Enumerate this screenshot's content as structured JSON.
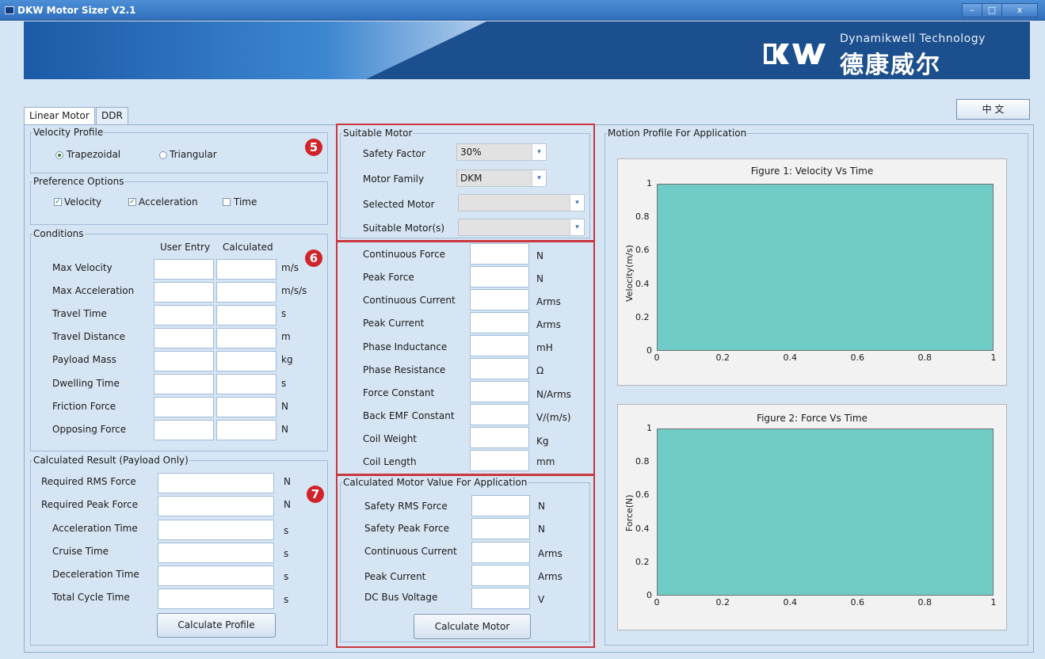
{
  "window": {
    "title": "DKW Motor Sizer V2.1",
    "minimize": "–",
    "maximize": "□",
    "close": "x"
  },
  "banner": {
    "company_en": "Dynamikwell Technology",
    "company_cn": "德康威尔"
  },
  "tabs": [
    {
      "label": "Linear Motor"
    },
    {
      "label": "DDR"
    }
  ],
  "lang_button": "中 文",
  "velocity_profile": {
    "legend": "Velocity Profile",
    "options": [
      {
        "label": "Trapezoidal",
        "selected": true
      },
      {
        "label": "Triangular",
        "selected": false
      }
    ]
  },
  "preference_options": {
    "legend": "Preference Options",
    "options": [
      {
        "label": "Velocity",
        "checked": true
      },
      {
        "label": "Acceleration",
        "checked": true
      },
      {
        "label": "Time",
        "checked": false
      }
    ]
  },
  "conditions": {
    "legend": "Conditions",
    "col_user": "User Entry",
    "col_calc": "Calculated",
    "rows": [
      {
        "label": "Max Velocity",
        "unit": "m/s"
      },
      {
        "label": "Max Acceleration",
        "unit": "m/s/s"
      },
      {
        "label": "Travel Time",
        "unit": "s"
      },
      {
        "label": "Travel Distance",
        "unit": "m"
      },
      {
        "label": "Payload Mass",
        "unit": "kg"
      },
      {
        "label": "Dwelling Time",
        "unit": "s"
      },
      {
        "label": "Friction Force",
        "unit": "N"
      },
      {
        "label": "Opposing Force",
        "unit": "N"
      }
    ]
  },
  "calculated_result": {
    "legend": "Calculated Result (Payload Only)",
    "rows": [
      {
        "label": "Required RMS Force",
        "unit": "N"
      },
      {
        "label": "Required Peak Force",
        "unit": "N"
      },
      {
        "label": "Acceleration Time",
        "unit": "s"
      },
      {
        "label": "Cruise Time",
        "unit": "s"
      },
      {
        "label": "Deceleration Time",
        "unit": "s"
      },
      {
        "label": "Total Cycle Time",
        "unit": "s"
      }
    ],
    "button": "Calculate Profile"
  },
  "badges": {
    "b5": "5",
    "b6": "6",
    "b7": "7"
  },
  "suitable_motor": {
    "legend": "Suitable Motor",
    "safety_factor_label": "Safety Factor",
    "safety_factor_value": "30%",
    "motor_family_label": "Motor Family",
    "motor_family_value": "DKM",
    "selected_motor_label": "Selected Motor",
    "selected_motor_value": "",
    "suitable_motors_label": "Suitable Motor(s)",
    "suitable_motors_value": ""
  },
  "motor_params": [
    {
      "label": "Continuous Force",
      "unit": "N"
    },
    {
      "label": "Peak Force",
      "unit": "N"
    },
    {
      "label": "Continuous Current",
      "unit": "Arms"
    },
    {
      "label": "Peak Current",
      "unit": "Arms"
    },
    {
      "label": "Phase Inductance",
      "unit": "mH"
    },
    {
      "label": "Phase Resistance",
      "unit": "Ω"
    },
    {
      "label": "Force Constant",
      "unit": "N/Arms"
    },
    {
      "label": "Back EMF Constant",
      "unit": "V/(m/s)"
    },
    {
      "label": "Coil Weight",
      "unit": "Kg"
    },
    {
      "label": "Coil Length",
      "unit": "mm"
    }
  ],
  "calc_motor_value": {
    "legend": "Calculated Motor Value For Application",
    "rows": [
      {
        "label": "Safety RMS Force",
        "unit": "N"
      },
      {
        "label": "Safety Peak Force",
        "unit": "N"
      },
      {
        "label": "Continuous Current",
        "unit": "Arms"
      },
      {
        "label": "Peak Current",
        "unit": "Arms"
      },
      {
        "label": "DC Bus Voltage",
        "unit": "V"
      }
    ],
    "button": "Calculate Motor"
  },
  "motion_profile": {
    "legend": "Motion Profile For Application"
  },
  "chart_data": [
    {
      "type": "area",
      "title": "Figure 1: Velocity Vs Time",
      "ylabel": "Velocity(m/s)",
      "xlabel": "",
      "xlim": [
        0,
        1
      ],
      "ylim": [
        0,
        1
      ],
      "xticks": [
        "0",
        "0.2",
        "0.4",
        "0.6",
        "0.8",
        "1"
      ],
      "yticks": [
        "0",
        "0.2",
        "0.4",
        "0.6",
        "0.8",
        "1"
      ],
      "fill_color": "#6ecbc6"
    },
    {
      "type": "area",
      "title": "Figure 2: Force Vs Time",
      "ylabel": "Force(N)",
      "xlabel": "",
      "xlim": [
        0,
        1
      ],
      "ylim": [
        0,
        1
      ],
      "xticks": [
        "0",
        "0.2",
        "0.4",
        "0.6",
        "0.8",
        "1"
      ],
      "yticks": [
        "0",
        "0.2",
        "0.4",
        "0.6",
        "0.8",
        "1"
      ],
      "fill_color": "#6ecbc6"
    }
  ]
}
